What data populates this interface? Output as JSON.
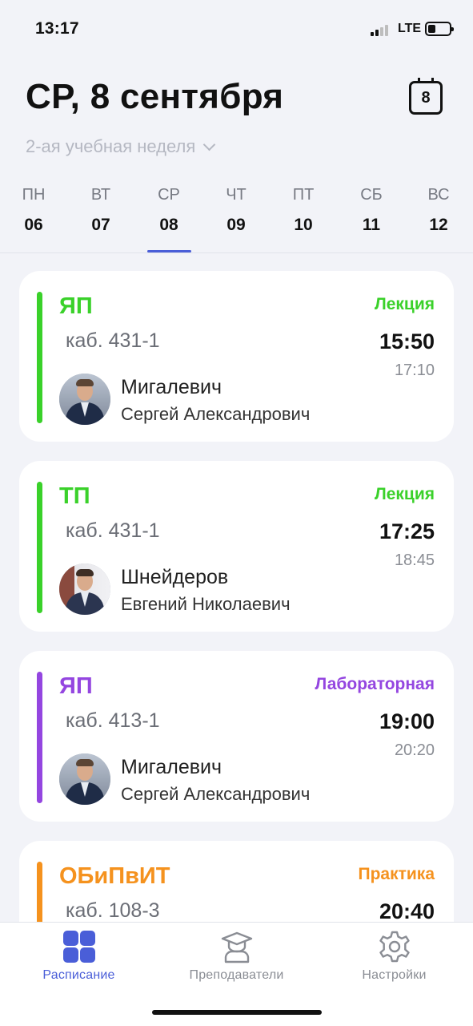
{
  "status_bar": {
    "time": "13:17",
    "network": "LTE"
  },
  "header": {
    "title": "СР, 8 сентября",
    "calendar_day": "8",
    "week_label": "2-ая учебная неделя"
  },
  "days": [
    {
      "dow": "ПН",
      "num": "06"
    },
    {
      "dow": "ВТ",
      "num": "07"
    },
    {
      "dow": "СР",
      "num": "08"
    },
    {
      "dow": "ЧТ",
      "num": "09"
    },
    {
      "dow": "ПТ",
      "num": "10"
    },
    {
      "dow": "СБ",
      "num": "11"
    },
    {
      "dow": "ВС",
      "num": "12"
    }
  ],
  "selected_day": "08",
  "lessons": [
    {
      "subject": "ЯП",
      "type": "Лекция",
      "room": "каб. 431-1",
      "start": "15:50",
      "end": "17:10",
      "teacher_last": "Мигалевич",
      "teacher_rest": "Сергей Александрович",
      "color": "#3ad12a"
    },
    {
      "subject": "ТП",
      "type": "Лекция",
      "room": "каб. 431-1",
      "start": "17:25",
      "end": "18:45",
      "teacher_last": "Шнейдеров",
      "teacher_rest": "Евгений Николаевич",
      "color": "#3ad12a"
    },
    {
      "subject": "ЯП",
      "type": "Лабораторная",
      "room": "каб. 413-1",
      "start": "19:00",
      "end": "20:20",
      "teacher_last": "Мигалевич",
      "teacher_rest": "Сергей Александрович",
      "color": "#9446e0"
    },
    {
      "subject": "ОБиПвИТ",
      "type": "Практика",
      "room": "каб. 108-3",
      "start": "20:40",
      "end": "",
      "teacher_last": "",
      "teacher_rest": "",
      "color": "#f5921e"
    }
  ],
  "tabs": [
    {
      "label": "Расписание",
      "icon": "schedule-grid-icon",
      "active": true
    },
    {
      "label": "Преподаватели",
      "icon": "teacher-icon",
      "active": false
    },
    {
      "label": "Настройки",
      "icon": "gear-icon",
      "active": false
    }
  ],
  "colors": {
    "accent": "#4a5ed8",
    "background": "#f2f3f8"
  }
}
